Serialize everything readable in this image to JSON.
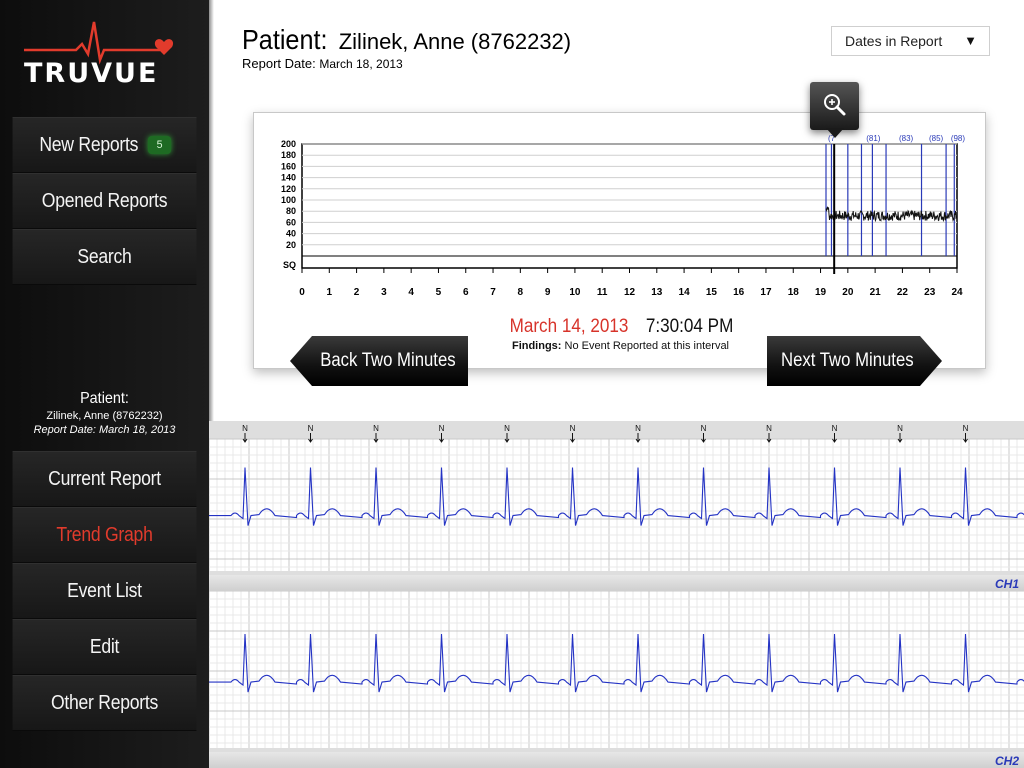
{
  "app": {
    "logo_text": "TRUVUE"
  },
  "sidebar": {
    "top_items": [
      {
        "label": "New Reports",
        "badge": "5"
      },
      {
        "label": "Opened Reports"
      },
      {
        "label": "Search"
      }
    ],
    "patient": {
      "title": "Patient:",
      "name": "Zilinek, Anne (8762232)",
      "report_date": "Report Date: March 18, 2013"
    },
    "bottom_items": [
      {
        "label": "Current Report",
        "active": false
      },
      {
        "label": "Trend Graph",
        "active": true
      },
      {
        "label": "Event List",
        "active": false
      },
      {
        "label": "Edit",
        "active": false
      },
      {
        "label": "Other Reports",
        "active": false
      }
    ]
  },
  "header": {
    "patient_label": "Patient:",
    "patient_name": "Zilinek, Anne (8762232)",
    "report_date_label": "Report Date:",
    "report_date_value": "March 18, 2013"
  },
  "dates_dropdown": {
    "selected": "Dates in Report",
    "arrow": "▼"
  },
  "trend": {
    "event_date": "March 14, 2013",
    "event_time": "7:30:04 PM",
    "findings_label": "Findings:",
    "findings_value": "No Event Reported at this interval",
    "back_button": "Back Two Minutes",
    "next_button": "Next Two Minutes",
    "zoom_icon": "zoom-in-icon"
  },
  "chart_data": {
    "type": "line",
    "y_ticks": [
      "200",
      "180",
      "160",
      "140",
      "120",
      "100",
      "80",
      "60",
      "40",
      "20",
      "SQ"
    ],
    "x_ticks": [
      "0",
      "1",
      "2",
      "3",
      "4",
      "5",
      "6",
      "7",
      "8",
      "9",
      "10",
      "11",
      "12",
      "13",
      "14",
      "15",
      "16",
      "17",
      "18",
      "19",
      "20",
      "21",
      "22",
      "23",
      "24"
    ],
    "ylim": [
      0,
      200
    ],
    "xlim": [
      0,
      24
    ],
    "series": [
      {
        "x_start": 19.2,
        "x_end": 24,
        "value_mean": 72,
        "value_min": 60,
        "value_max": 95
      }
    ],
    "event_markers": [
      {
        "label": "(7",
        "x": 19.2
      },
      {
        "label": "(81)",
        "x": 20.6
      },
      {
        "label": "(83)",
        "x": 21.8
      },
      {
        "label": "(85)",
        "x": 22.9
      },
      {
        "label": "(98)",
        "x": 23.7
      }
    ],
    "event_lines_x": [
      19.2,
      19.4,
      20.0,
      20.5,
      20.9,
      21.4,
      22.7,
      23.6,
      23.9
    ],
    "current_position_x": 19.5,
    "grid": true
  },
  "ecg": {
    "beat_label": "N",
    "channels": [
      "CH1",
      "CH2"
    ],
    "beats": 12,
    "trace_color": "#2433c4"
  },
  "colors": {
    "accent_red": "#d7332a",
    "sidebar_bg": "#161616",
    "badge_green": "#1e6a23",
    "trace_blue": "#2433c4"
  }
}
